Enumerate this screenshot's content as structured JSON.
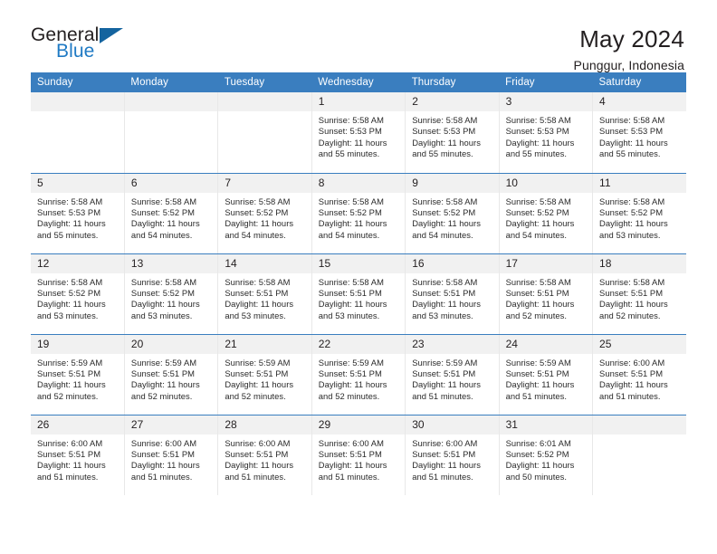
{
  "logo": {
    "word_top": "General",
    "word_bottom": "Blue",
    "triangle_color": "#14649f",
    "blue_color": "#1f7ac4"
  },
  "header": {
    "title": "May 2024",
    "subtitle": "Punggur, Indonesia",
    "accent_color": "#3a7ebf",
    "daynum_band_color": "#f1f1f1"
  },
  "weekday_headers": [
    "Sunday",
    "Monday",
    "Tuesday",
    "Wednesday",
    "Thursday",
    "Friday",
    "Saturday"
  ],
  "labels": {
    "sunrise": "Sunrise:",
    "sunset": "Sunset:",
    "daylight": "Daylight:"
  },
  "weeks": [
    [
      {
        "day": "",
        "blank": true
      },
      {
        "day": "",
        "blank": true
      },
      {
        "day": "",
        "blank": true
      },
      {
        "day": "1",
        "sunrise": "Sunrise: 5:58 AM",
        "sunset": "Sunset: 5:53 PM",
        "daylight_line1": "Daylight: 11 hours",
        "daylight_line2": "and 55 minutes."
      },
      {
        "day": "2",
        "sunrise": "Sunrise: 5:58 AM",
        "sunset": "Sunset: 5:53 PM",
        "daylight_line1": "Daylight: 11 hours",
        "daylight_line2": "and 55 minutes."
      },
      {
        "day": "3",
        "sunrise": "Sunrise: 5:58 AM",
        "sunset": "Sunset: 5:53 PM",
        "daylight_line1": "Daylight: 11 hours",
        "daylight_line2": "and 55 minutes."
      },
      {
        "day": "4",
        "sunrise": "Sunrise: 5:58 AM",
        "sunset": "Sunset: 5:53 PM",
        "daylight_line1": "Daylight: 11 hours",
        "daylight_line2": "and 55 minutes."
      }
    ],
    [
      {
        "day": "5",
        "sunrise": "Sunrise: 5:58 AM",
        "sunset": "Sunset: 5:53 PM",
        "daylight_line1": "Daylight: 11 hours",
        "daylight_line2": "and 55 minutes."
      },
      {
        "day": "6",
        "sunrise": "Sunrise: 5:58 AM",
        "sunset": "Sunset: 5:52 PM",
        "daylight_line1": "Daylight: 11 hours",
        "daylight_line2": "and 54 minutes."
      },
      {
        "day": "7",
        "sunrise": "Sunrise: 5:58 AM",
        "sunset": "Sunset: 5:52 PM",
        "daylight_line1": "Daylight: 11 hours",
        "daylight_line2": "and 54 minutes."
      },
      {
        "day": "8",
        "sunrise": "Sunrise: 5:58 AM",
        "sunset": "Sunset: 5:52 PM",
        "daylight_line1": "Daylight: 11 hours",
        "daylight_line2": "and 54 minutes."
      },
      {
        "day": "9",
        "sunrise": "Sunrise: 5:58 AM",
        "sunset": "Sunset: 5:52 PM",
        "daylight_line1": "Daylight: 11 hours",
        "daylight_line2": "and 54 minutes."
      },
      {
        "day": "10",
        "sunrise": "Sunrise: 5:58 AM",
        "sunset": "Sunset: 5:52 PM",
        "daylight_line1": "Daylight: 11 hours",
        "daylight_line2": "and 54 minutes."
      },
      {
        "day": "11",
        "sunrise": "Sunrise: 5:58 AM",
        "sunset": "Sunset: 5:52 PM",
        "daylight_line1": "Daylight: 11 hours",
        "daylight_line2": "and 53 minutes."
      }
    ],
    [
      {
        "day": "12",
        "sunrise": "Sunrise: 5:58 AM",
        "sunset": "Sunset: 5:52 PM",
        "daylight_line1": "Daylight: 11 hours",
        "daylight_line2": "and 53 minutes."
      },
      {
        "day": "13",
        "sunrise": "Sunrise: 5:58 AM",
        "sunset": "Sunset: 5:52 PM",
        "daylight_line1": "Daylight: 11 hours",
        "daylight_line2": "and 53 minutes."
      },
      {
        "day": "14",
        "sunrise": "Sunrise: 5:58 AM",
        "sunset": "Sunset: 5:51 PM",
        "daylight_line1": "Daylight: 11 hours",
        "daylight_line2": "and 53 minutes."
      },
      {
        "day": "15",
        "sunrise": "Sunrise: 5:58 AM",
        "sunset": "Sunset: 5:51 PM",
        "daylight_line1": "Daylight: 11 hours",
        "daylight_line2": "and 53 minutes."
      },
      {
        "day": "16",
        "sunrise": "Sunrise: 5:58 AM",
        "sunset": "Sunset: 5:51 PM",
        "daylight_line1": "Daylight: 11 hours",
        "daylight_line2": "and 53 minutes."
      },
      {
        "day": "17",
        "sunrise": "Sunrise: 5:58 AM",
        "sunset": "Sunset: 5:51 PM",
        "daylight_line1": "Daylight: 11 hours",
        "daylight_line2": "and 52 minutes."
      },
      {
        "day": "18",
        "sunrise": "Sunrise: 5:58 AM",
        "sunset": "Sunset: 5:51 PM",
        "daylight_line1": "Daylight: 11 hours",
        "daylight_line2": "and 52 minutes."
      }
    ],
    [
      {
        "day": "19",
        "sunrise": "Sunrise: 5:59 AM",
        "sunset": "Sunset: 5:51 PM",
        "daylight_line1": "Daylight: 11 hours",
        "daylight_line2": "and 52 minutes."
      },
      {
        "day": "20",
        "sunrise": "Sunrise: 5:59 AM",
        "sunset": "Sunset: 5:51 PM",
        "daylight_line1": "Daylight: 11 hours",
        "daylight_line2": "and 52 minutes."
      },
      {
        "day": "21",
        "sunrise": "Sunrise: 5:59 AM",
        "sunset": "Sunset: 5:51 PM",
        "daylight_line1": "Daylight: 11 hours",
        "daylight_line2": "and 52 minutes."
      },
      {
        "day": "22",
        "sunrise": "Sunrise: 5:59 AM",
        "sunset": "Sunset: 5:51 PM",
        "daylight_line1": "Daylight: 11 hours",
        "daylight_line2": "and 52 minutes."
      },
      {
        "day": "23",
        "sunrise": "Sunrise: 5:59 AM",
        "sunset": "Sunset: 5:51 PM",
        "daylight_line1": "Daylight: 11 hours",
        "daylight_line2": "and 51 minutes."
      },
      {
        "day": "24",
        "sunrise": "Sunrise: 5:59 AM",
        "sunset": "Sunset: 5:51 PM",
        "daylight_line1": "Daylight: 11 hours",
        "daylight_line2": "and 51 minutes."
      },
      {
        "day": "25",
        "sunrise": "Sunrise: 6:00 AM",
        "sunset": "Sunset: 5:51 PM",
        "daylight_line1": "Daylight: 11 hours",
        "daylight_line2": "and 51 minutes."
      }
    ],
    [
      {
        "day": "26",
        "sunrise": "Sunrise: 6:00 AM",
        "sunset": "Sunset: 5:51 PM",
        "daylight_line1": "Daylight: 11 hours",
        "daylight_line2": "and 51 minutes."
      },
      {
        "day": "27",
        "sunrise": "Sunrise: 6:00 AM",
        "sunset": "Sunset: 5:51 PM",
        "daylight_line1": "Daylight: 11 hours",
        "daylight_line2": "and 51 minutes."
      },
      {
        "day": "28",
        "sunrise": "Sunrise: 6:00 AM",
        "sunset": "Sunset: 5:51 PM",
        "daylight_line1": "Daylight: 11 hours",
        "daylight_line2": "and 51 minutes."
      },
      {
        "day": "29",
        "sunrise": "Sunrise: 6:00 AM",
        "sunset": "Sunset: 5:51 PM",
        "daylight_line1": "Daylight: 11 hours",
        "daylight_line2": "and 51 minutes."
      },
      {
        "day": "30",
        "sunrise": "Sunrise: 6:00 AM",
        "sunset": "Sunset: 5:51 PM",
        "daylight_line1": "Daylight: 11 hours",
        "daylight_line2": "and 51 minutes."
      },
      {
        "day": "31",
        "sunrise": "Sunrise: 6:01 AM",
        "sunset": "Sunset: 5:52 PM",
        "daylight_line1": "Daylight: 11 hours",
        "daylight_line2": "and 50 minutes."
      },
      {
        "day": "",
        "blank": true
      }
    ]
  ]
}
